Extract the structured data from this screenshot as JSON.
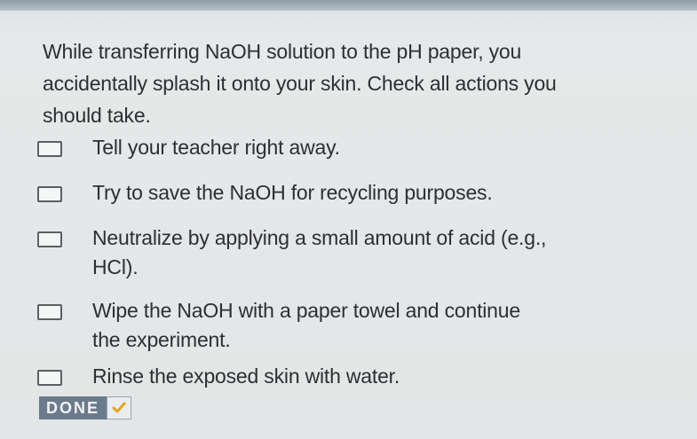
{
  "question": {
    "text": "While transferring NaOH solution to the pH paper, you accidentally splash it onto your skin. Check all actions you should take."
  },
  "options": [
    {
      "label": "Tell your teacher right away.",
      "checked": false
    },
    {
      "label": "Try to save the NaOH for recycling purposes.",
      "checked": false
    },
    {
      "label": "Neutralize by applying a small amount of acid (e.g., HCl).",
      "checked": false
    },
    {
      "label": "Wipe the NaOH with a paper towel and continue the experiment.",
      "checked": false
    },
    {
      "label": "Rinse the exposed skin with water.",
      "checked": false
    }
  ],
  "done_button": {
    "label": "DONE",
    "icon": "checkmark-icon"
  },
  "colors": {
    "done_bg": "#6c7b8b",
    "check": "#e8a21a",
    "text": "#2e2f32"
  }
}
